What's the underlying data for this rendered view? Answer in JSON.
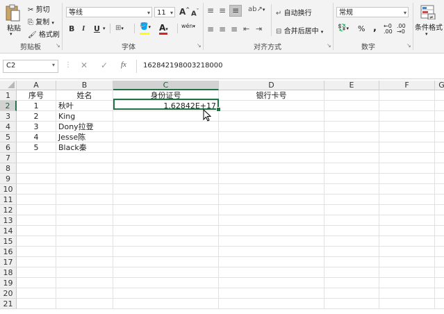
{
  "ribbon": {
    "clipboard": {
      "paste": "粘贴",
      "cut": "剪切",
      "copy": "复制",
      "format_painter": "格式刷",
      "label": "剪贴板"
    },
    "font": {
      "font_name": "等线",
      "font_size": "11",
      "grow": "A",
      "shrink": "A",
      "bold": "B",
      "italic": "I",
      "underline": "U",
      "wen": "wén",
      "label": "字体"
    },
    "alignment": {
      "wrap_text": "自动换行",
      "merge_center": "合并后居中",
      "label": "对齐方式"
    },
    "number": {
      "format": "常规",
      "percent": "%",
      "comma": ",",
      "label": "数字"
    },
    "styles": {
      "conditional_formatting": "条件格式"
    }
  },
  "formula_bar": {
    "name_box": "C2",
    "cancel": "✕",
    "enter": "✓",
    "fx": "fx",
    "content": "162842198003218000"
  },
  "columns": [
    "A",
    "B",
    "C",
    "D",
    "E",
    "F",
    "G"
  ],
  "selected_column": "C",
  "rows": [
    "1",
    "2",
    "3",
    "4",
    "5",
    "6",
    "7",
    "8",
    "9",
    "10",
    "11",
    "12",
    "13",
    "14",
    "15",
    "16",
    "17",
    "18",
    "19",
    "20",
    "21"
  ],
  "selected_row": "2",
  "cells": {
    "A1": "序号",
    "B1": "姓名",
    "C1": "身份证号",
    "D1": "银行卡号",
    "A2": "1",
    "B2": "秋叶",
    "C2": "1.62842E+17",
    "A3": "2",
    "B3": "King",
    "A4": "3",
    "B4": "Dony拉登",
    "A5": "4",
    "B5": "Jesse陈",
    "A6": "5",
    "B6": "Black秦"
  },
  "colors": {
    "selection": "#217346",
    "header_selected": "#d2d2d2",
    "font_color_bar": "#e02020",
    "highlight_bar": "#ffff00"
  }
}
